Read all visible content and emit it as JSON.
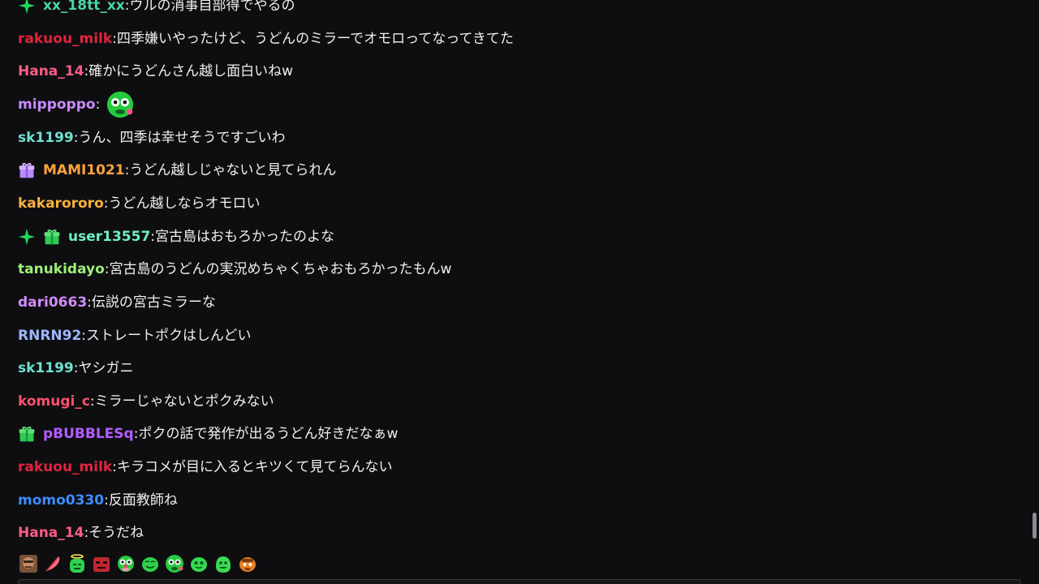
{
  "colors": {
    "background": "#0e0e10",
    "message_text": "#efeff1"
  },
  "chat": {
    "messages": [
      {
        "username": "xx_18tt_xx",
        "text": "ウルの消事自部得でやるの",
        "color": "#4cd3a7",
        "badges": [
          "sparkle-badge"
        ],
        "emote": null
      },
      {
        "username": "rakuou_milk",
        "text": "四季嫌いやったけど、うどんのミラーでオモロってなってきてた",
        "color": "#e0243c",
        "badges": [],
        "emote": null
      },
      {
        "username": "Hana_14",
        "text": "確かにうどんさん越し面白いねw",
        "color": "#ff5c84",
        "badges": [],
        "emote": null
      },
      {
        "username": "mippoppo",
        "text": "",
        "color": "#c88bff",
        "badges": [],
        "emote": "green-face-emote"
      },
      {
        "username": "sk1199",
        "text": "うん、四季は幸せそうですごいわ",
        "color": "#6fe0d0",
        "badges": [],
        "emote": null
      },
      {
        "username": "MAMI1021",
        "text": "うどん越しじゃないと見てられん",
        "color": "#ffa33c",
        "badges": [
          "gift-badge-purple"
        ],
        "emote": null
      },
      {
        "username": "kakarororo",
        "text": "うどん越しならオモロい",
        "color": "#ffb13c",
        "badges": [],
        "emote": null
      },
      {
        "username": "user13557",
        "text": "宮古島はおもろかったのよな",
        "color": "#6ff0c0",
        "badges": [
          "sparkle-badge",
          "gift-badge-green"
        ],
        "emote": null
      },
      {
        "username": "tanukidayo",
        "text": "宮古島のうどんの実況めちゃくちゃおもろかったもんw",
        "color": "#9ef07a",
        "badges": [],
        "emote": null
      },
      {
        "username": "dari0663",
        "text": "伝説の宮古ミラーな",
        "color": "#d38bff",
        "badges": [],
        "emote": null
      },
      {
        "username": "RNRN92",
        "text": "ストレートポクはしんどい",
        "color": "#9fb6ff",
        "badges": [],
        "emote": null
      },
      {
        "username": "sk1199",
        "text": "ヤシガニ",
        "color": "#6fe0d0",
        "badges": [],
        "emote": null
      },
      {
        "username": "komugi_c",
        "text": "ミラーじゃないとポクみない",
        "color": "#ff4f6e",
        "badges": [],
        "emote": null
      },
      {
        "username": "pBUBBLESq",
        "text": "ポクの話で発作が出るうどん好きだなぁw",
        "color": "#b45cff",
        "badges": [
          "gift-badge-green"
        ],
        "emote": null
      },
      {
        "username": "rakuou_milk",
        "text": "キラコメが目に入るとキツくて見てらんない",
        "color": "#e0243c",
        "badges": [],
        "emote": null
      },
      {
        "username": "momo0330",
        "text": "反面教師ね",
        "color": "#3d8cff",
        "badges": [],
        "emote": null
      },
      {
        "username": "Hana_14",
        "text": "そうだね",
        "color": "#ff5c84",
        "badges": [],
        "emote": null
      }
    ]
  },
  "emote_tray": {
    "emotes": [
      "face-photo-emote",
      "feather-emote",
      "green-halo-emote",
      "red-block-emote",
      "green-clown-emote",
      "green-smile-emote",
      "green-face-emote",
      "green-blob-emote",
      "green-grin-emote",
      "orange-face-emote"
    ]
  }
}
